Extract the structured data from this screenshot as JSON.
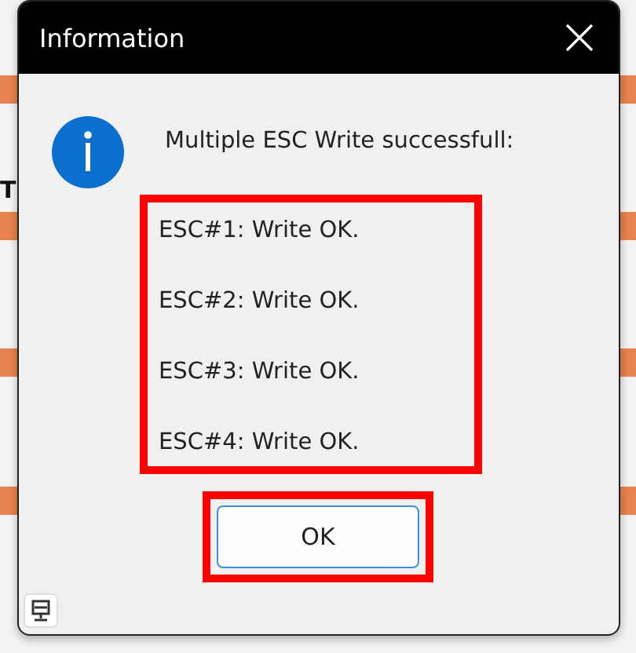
{
  "background_window": {
    "fragment": "T"
  },
  "dialog": {
    "title": "Information",
    "message": "Multiple ESC Write successfull:",
    "results": [
      "ESC#1: Write OK.",
      "ESC#2: Write OK.",
      "ESC#3: Write OK.",
      "ESC#4: Write OK."
    ],
    "buttons": [
      "OK"
    ]
  }
}
